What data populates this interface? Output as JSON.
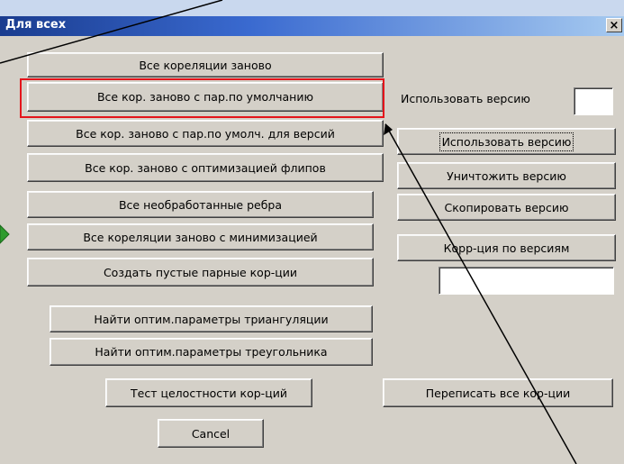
{
  "window": {
    "title": "Для всех",
    "close_glyph": "×"
  },
  "left_buttons": [
    "Все кореляции заново",
    "Все кор. заново с пар.по умолчанию",
    "Все кор. заново с пар.по умолч. для версий",
    "Все кор. заново с оптимизацией флипов",
    "Все необработанные ребра",
    "Все кореляции заново с минимизацией",
    "Создать пустые парные кор-ции",
    "Найти оптим.параметры триангуляции",
    "Найти оптим.параметры треугольника",
    "Тест целостности кор-ций",
    "Cancel"
  ],
  "right_panel": {
    "use_version_label": "Использовать версию",
    "use_version_button": "Использовать версию",
    "delete_version_button": "Уничтожить версию",
    "copy_version_button": "Скопировать версию",
    "corr_by_versions_button": "Корр-ция по версиям",
    "rewrite_all_button": "Переписать все кор-ции"
  },
  "colors": {
    "highlight": "#e4141b",
    "annotation": "#000000",
    "marker": "#2e9b2e"
  }
}
